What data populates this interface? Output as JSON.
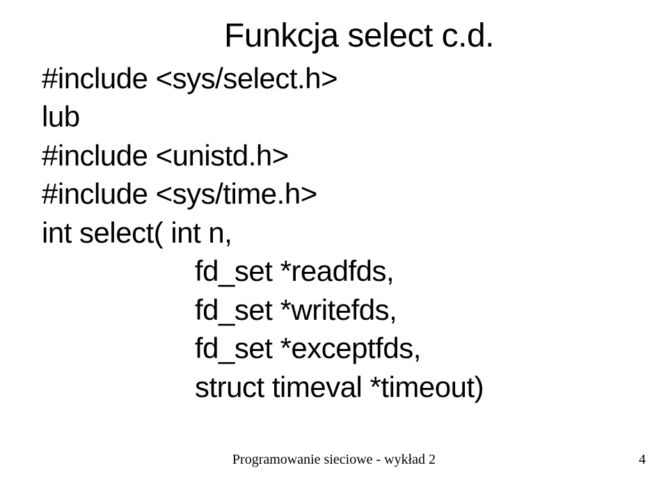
{
  "title": "Funkcja select c.d.",
  "line1": "#include <sys/select.h>",
  "line2": "lub",
  "line3": "#include <unistd.h>",
  "line4": "#include <sys/time.h>",
  "line5": "int select(\tint n,",
  "line6": "fd_set *readfds,",
  "line7": "fd_set *writefds,",
  "line8": "fd_set *exceptfds,",
  "line9": "struct timeval *timeout)",
  "footer": "Programowanie sieciowe - wykład 2",
  "page": "4"
}
